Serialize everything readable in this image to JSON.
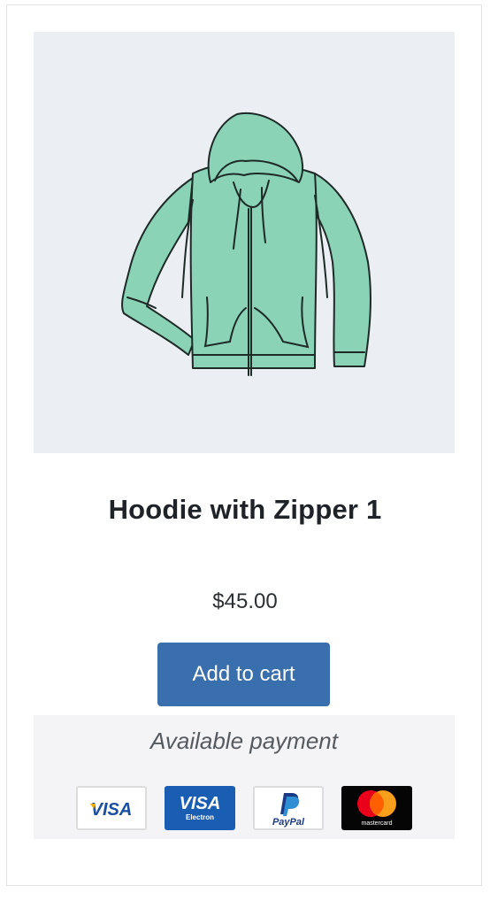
{
  "product": {
    "title": "Hoodie with Zipper 1",
    "price": "$45.00",
    "add_to_cart_label": "Add to cart",
    "image_icon": "hoodie-illustration",
    "image_color": "#8ad3b7"
  },
  "payment": {
    "title": "Available payment",
    "methods": [
      {
        "icon": "visa-icon",
        "label": "VISA"
      },
      {
        "icon": "visa-electron-icon",
        "label": "VISA",
        "sub": "Electron"
      },
      {
        "icon": "paypal-icon",
        "label": "PayPal"
      },
      {
        "icon": "mastercard-icon",
        "label": "mastercard"
      }
    ]
  },
  "colors": {
    "button": "#3a6fad",
    "image_bg": "#ebeef3",
    "payment_bg": "#f4f4f6"
  }
}
